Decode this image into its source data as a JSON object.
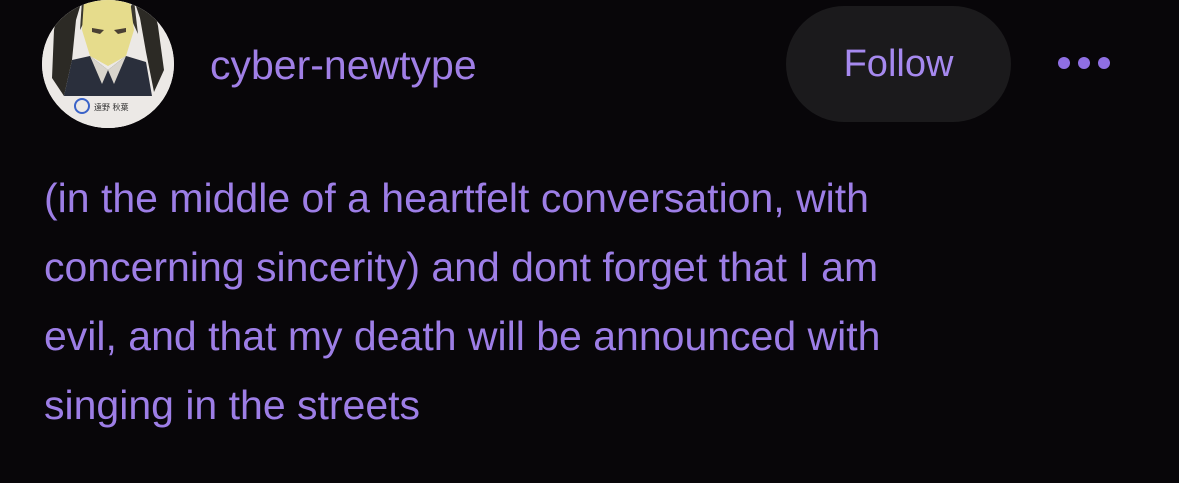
{
  "post": {
    "author": {
      "username": "cyber-newtype",
      "avatar_icon": "anime-character-avatar-icon",
      "avatar_caption": "遠野 秋葉"
    },
    "follow_label": "Follow",
    "more_icon": "ellipsis-icon",
    "body_lines": [
      "(in the middle of a heartfelt conversation, with",
      "concerning sincerity) and dont forget that I am",
      "evil, and that my death will be announced with",
      "singing in the streets"
    ]
  },
  "colors": {
    "background": "#080609",
    "accent_text": "#9d7ee6",
    "button_background": "#1b1a1c"
  }
}
